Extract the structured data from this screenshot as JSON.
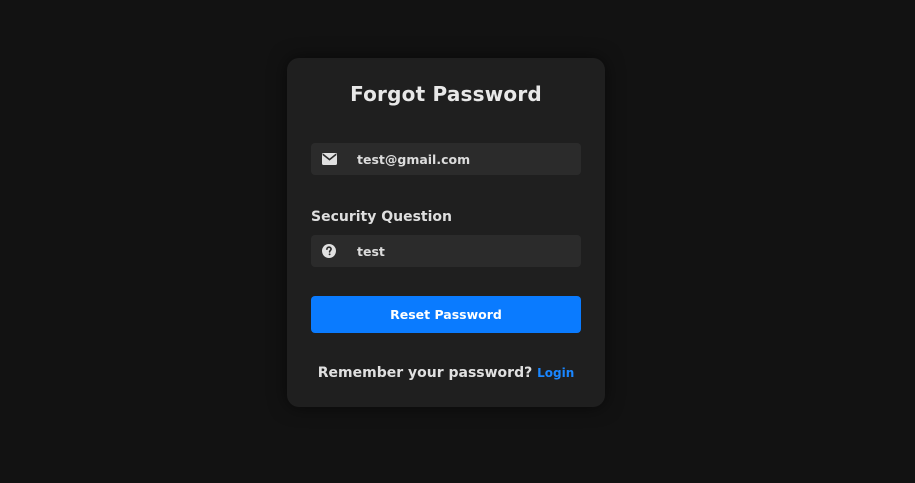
{
  "form": {
    "title": "Forgot Password",
    "email": {
      "value": "test@gmail.com",
      "icon": "envelope-icon"
    },
    "security_question_label": "Security Question",
    "answer": {
      "value": "test",
      "icon": "question-circle-icon"
    },
    "reset_button_label": "Reset Password",
    "remember_text": "Remember your password?",
    "login_link_label": "Login"
  },
  "colors": {
    "background": "#121212",
    "card": "#1f1f1f",
    "field": "#2b2b2b",
    "accent": "#0a7bff",
    "link": "#1a86ff"
  }
}
